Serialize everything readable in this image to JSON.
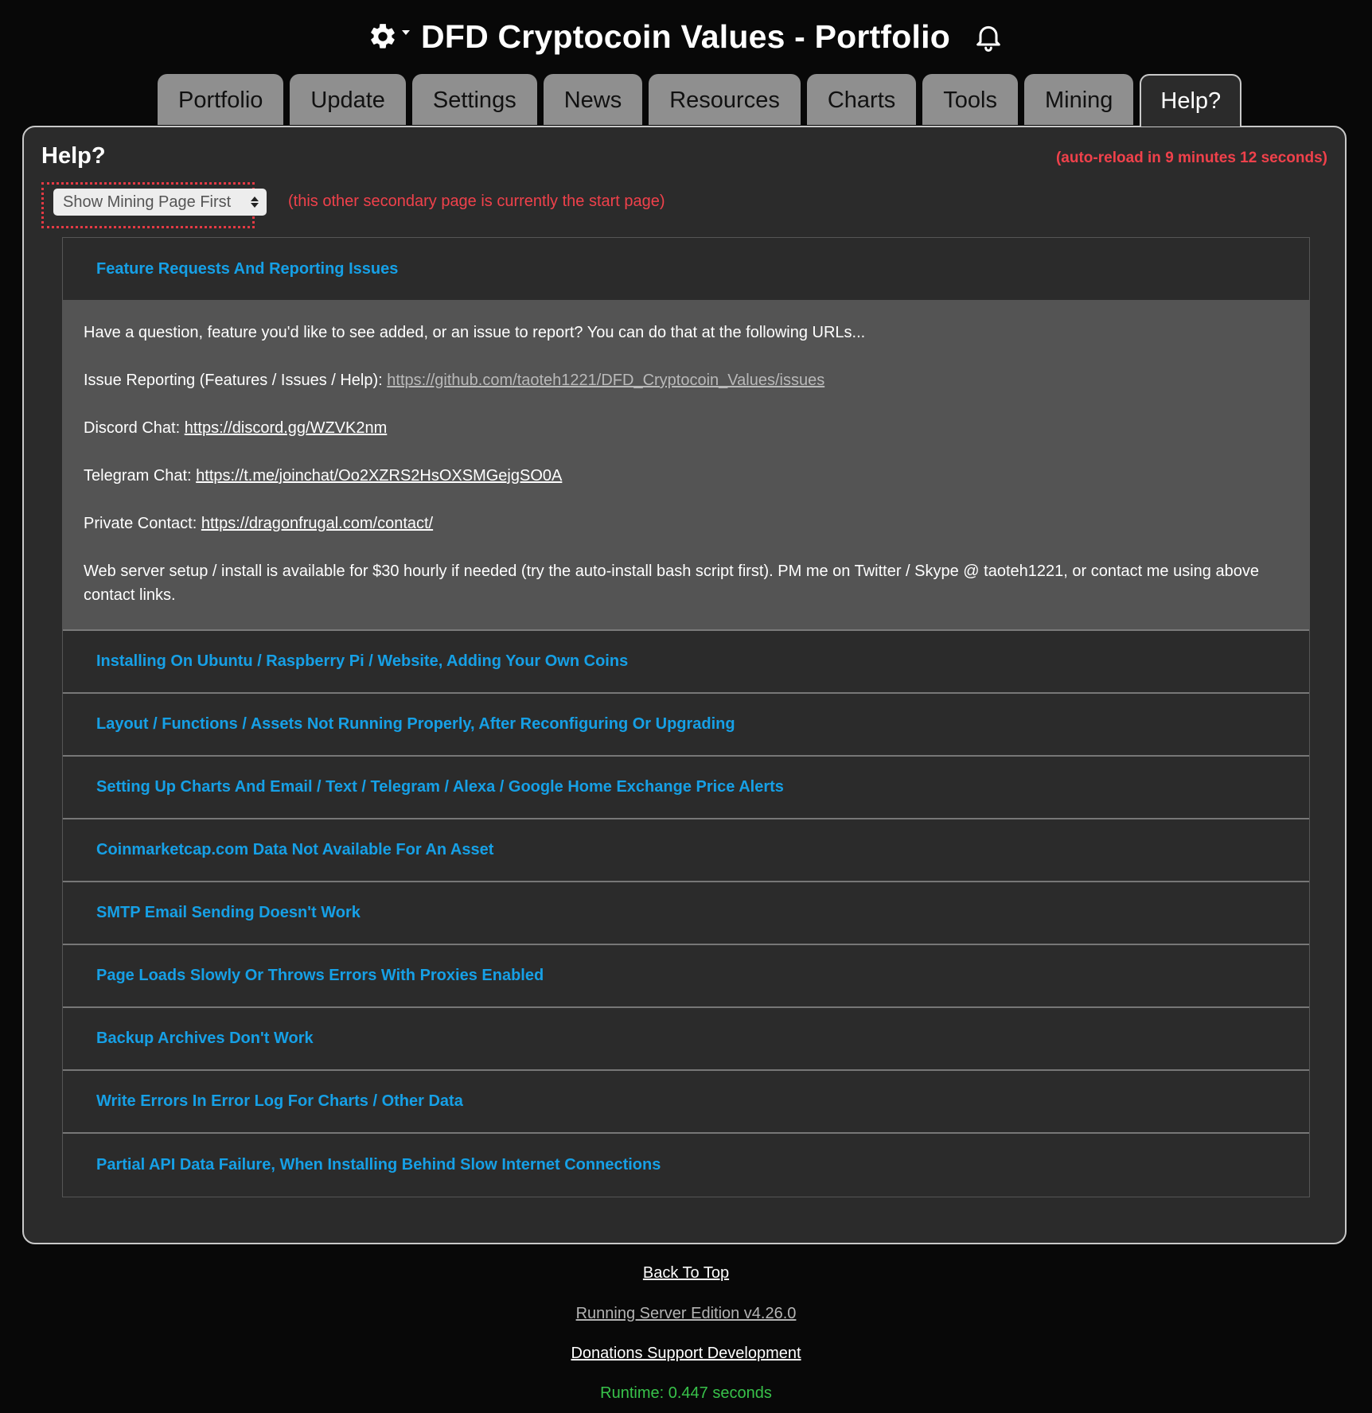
{
  "header": {
    "title": "DFD Cryptocoin Values - Portfolio",
    "settings_icon": "gear-icon",
    "alerts_icon": "bell-icon"
  },
  "tabs": [
    {
      "label": "Portfolio"
    },
    {
      "label": "Update"
    },
    {
      "label": "Settings"
    },
    {
      "label": "News"
    },
    {
      "label": "Resources"
    },
    {
      "label": "Charts"
    },
    {
      "label": "Tools"
    },
    {
      "label": "Mining"
    },
    {
      "label": "Help?",
      "active": true
    }
  ],
  "panel": {
    "title": "Help?",
    "auto_reload": "(auto-reload in 9 minutes 12 seconds)",
    "start_page_select": "Show Mining Page First",
    "start_page_note": "(this other secondary page is currently the start page)"
  },
  "faq": {
    "open_section": {
      "title": "Feature Requests And Reporting Issues",
      "intro": "Have a question, feature you'd like to see added, or an issue to report? You can do that at the following URLs...",
      "issue_label": "Issue Reporting (Features / Issues / Help): ",
      "issue_url": "https://github.com/taoteh1221/DFD_Cryptocoin_Values/issues",
      "discord_label": "Discord Chat: ",
      "discord_url": "https://discord.gg/WZVK2nm",
      "telegram_label": "Telegram Chat: ",
      "telegram_url": "https://t.me/joinchat/Oo2XZRS2HsOXSMGejgSO0A",
      "private_label": "Private Contact: ",
      "private_url": "https://dragonfrugal.com/contact/",
      "setup_note": "Web server setup / install is available for $30 hourly if needed (try the auto-install bash script first). PM me on Twitter / Skype @ taoteh1221, or contact me using above contact links."
    },
    "sections": [
      "Installing On Ubuntu / Raspberry Pi / Website, Adding Your Own Coins",
      "Layout / Functions / Assets Not Running Properly, After Reconfiguring Or Upgrading",
      "Setting Up Charts And Email / Text / Telegram / Alexa / Google Home Exchange Price Alerts",
      "Coinmarketcap.com Data Not Available For An Asset",
      "SMTP Email Sending Doesn't Work",
      "Page Loads Slowly Or Throws Errors With Proxies Enabled",
      "Backup Archives Don't Work",
      "Write Errors In Error Log For Charts / Other Data",
      "Partial API Data Failure, When Installing Behind Slow Internet Connections"
    ]
  },
  "footer": {
    "back_to_top": "Back To Top",
    "version": "Running Server Edition v4.26.0",
    "donations": "Donations Support Development",
    "runtime": "Runtime: 0.447 seconds"
  },
  "colors": {
    "background": "#080808",
    "panel": "#2b2b2b",
    "accent_link": "#16a0e6",
    "alert_red": "#f0414b",
    "runtime_green": "#38c24a"
  }
}
